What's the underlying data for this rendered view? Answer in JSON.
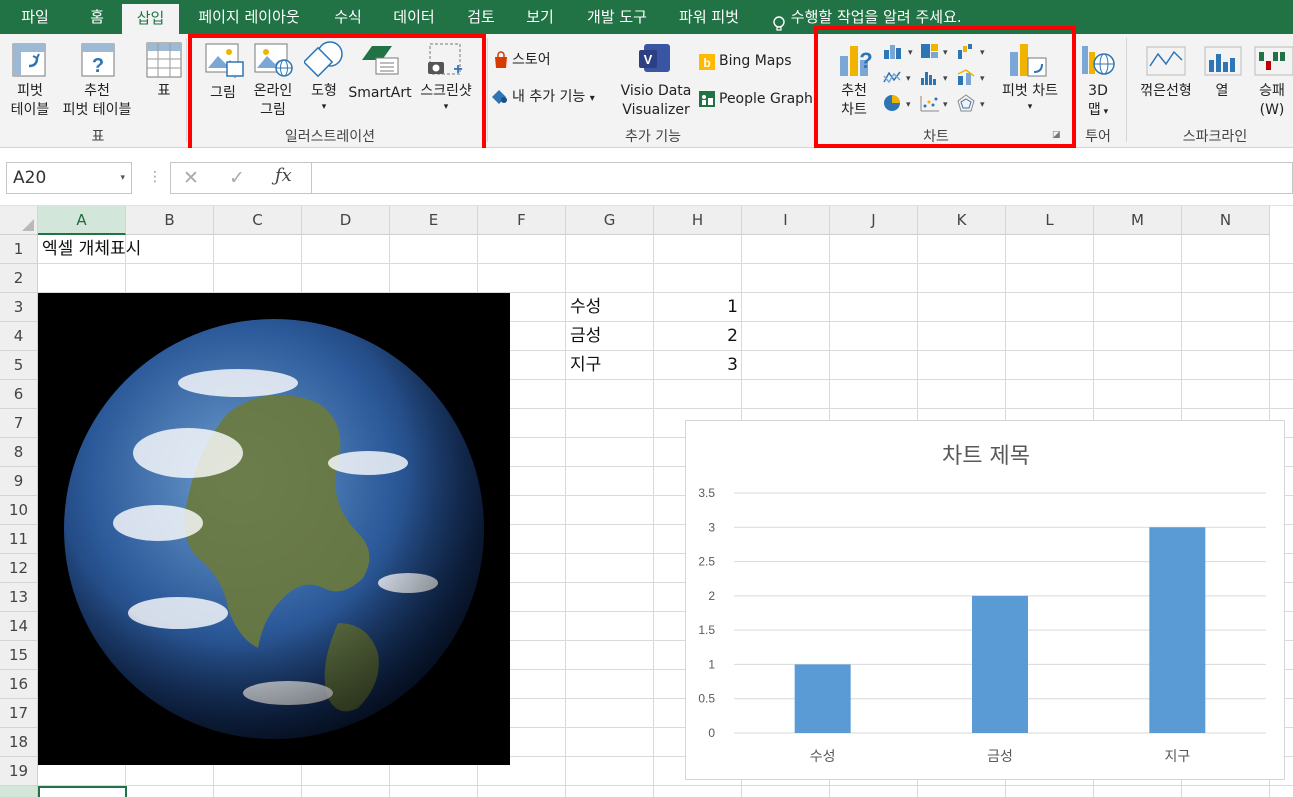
{
  "tabs": [
    "파일",
    "홈",
    "삽입",
    "페이지 레이아웃",
    "수식",
    "데이터",
    "검토",
    "보기",
    "개발 도구",
    "파워 피벗"
  ],
  "tell_me": "수행할 작업을 알려 주세요.",
  "ribbon": {
    "tables": {
      "pivot_table": [
        "피벗",
        "테이블"
      ],
      "recommended_pivot": [
        "추천",
        "피벗 테이블"
      ],
      "table": "표",
      "group_label": "표"
    },
    "illustrations": {
      "picture": "그림",
      "online_picture": [
        "온라인",
        "그림"
      ],
      "shapes": "도형",
      "smartart": "SmartArt",
      "screenshot": "스크린샷",
      "group_label": "일러스트레이션"
    },
    "addins": {
      "store": "스토어",
      "my_addins": "내 추가 기능",
      "visio": [
        "Visio Data",
        "Visualizer"
      ],
      "bing_maps": "Bing Maps",
      "people_graph": "People Graph",
      "group_label": "추가 기능"
    },
    "charts": {
      "recommended": [
        "추천",
        "차트"
      ],
      "pivot_chart": "피벗 차트",
      "group_label": "차트"
    },
    "tours": {
      "map3d": [
        "3D",
        "맵"
      ],
      "group_label": "투어"
    },
    "sparklines": {
      "line": "꺾은선형",
      "column": "열",
      "winloss": [
        "승패",
        "(W)"
      ],
      "group_label": "스파크라인"
    }
  },
  "formula_bar": {
    "name_box": "A20",
    "formula": ""
  },
  "columns": [
    "A",
    "B",
    "C",
    "D",
    "E",
    "F",
    "G",
    "H",
    "I",
    "J",
    "K",
    "L",
    "M",
    "N"
  ],
  "rows": [
    "1",
    "2",
    "3",
    "4",
    "5",
    "6",
    "7",
    "8",
    "9",
    "10",
    "11",
    "12",
    "13",
    "14",
    "15",
    "16",
    "17",
    "18",
    "19"
  ],
  "cells": {
    "a1": "엑셀 개체표시",
    "g3": "수성",
    "h3": "1",
    "g4": "금성",
    "h4": "2",
    "g5": "지구",
    "h5": "3"
  },
  "chart_data": {
    "type": "bar",
    "title": "차트 제목",
    "categories": [
      "수성",
      "금성",
      "지구"
    ],
    "values": [
      1,
      2,
      3
    ],
    "ylim": [
      0,
      3.5
    ],
    "yticks": [
      "0",
      "0.5",
      "1",
      "1.5",
      "2",
      "2.5",
      "3",
      "3.5"
    ],
    "grid": true,
    "color": "#5b9bd5"
  },
  "colors": {
    "accent": "#217346",
    "highlight_box": "#ff0000"
  },
  "image_description_icon": "earth-photo"
}
